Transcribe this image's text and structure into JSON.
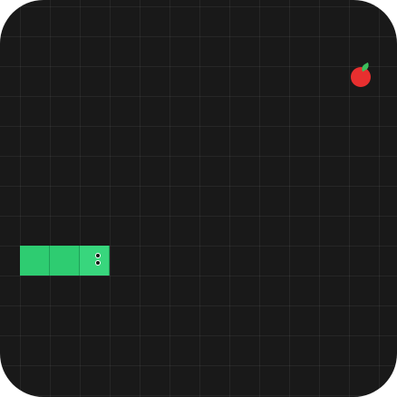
{
  "game": {
    "grid": {
      "columns": 13,
      "rows": 13
    },
    "snake": {
      "segments": [
        {
          "col": 1,
          "row": 8
        },
        {
          "col": 2,
          "row": 8
        },
        {
          "col": 3,
          "row": 8
        }
      ],
      "head_index": 2,
      "direction": "right"
    },
    "apple": {
      "col": 12,
      "row": 2
    },
    "colors": {
      "board": "#191919",
      "snake_body": "#2ecc71",
      "snake_head": "#38d67d",
      "apple": "#e82f2f",
      "apple_leaf": "#3bbf5c"
    }
  }
}
